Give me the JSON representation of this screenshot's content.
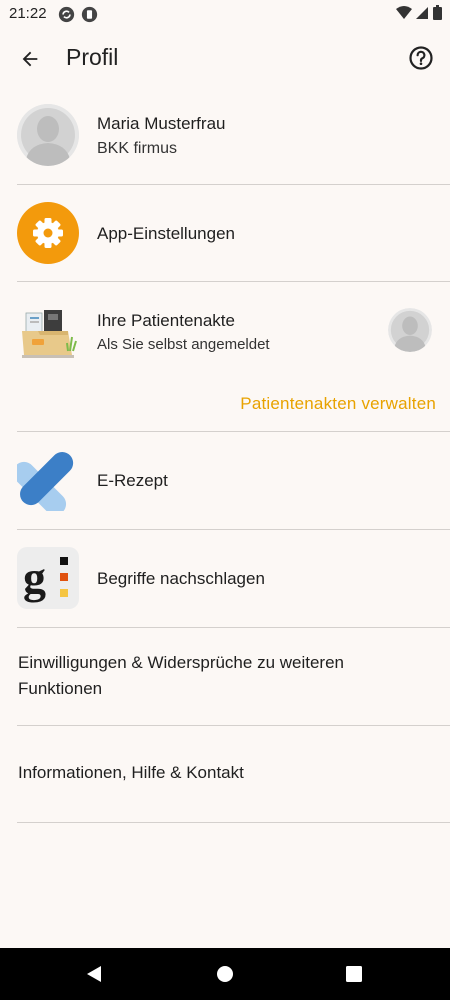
{
  "status_bar": {
    "time": "21:22"
  },
  "app_bar": {
    "title": "Profil"
  },
  "profile": {
    "name": "Maria Musterfrau",
    "insurance": "BKK firmus"
  },
  "app_settings": {
    "label": "App-Einstellungen"
  },
  "patient_record": {
    "title": "Ihre Patientenakte",
    "subtitle": "Als Sie selbst angemeldet",
    "manage_link": "Patientenakten verwalten"
  },
  "erezept": {
    "label": "E-Rezept"
  },
  "glossary": {
    "label": "Begriffe nachschlagen"
  },
  "consents": {
    "label": "Einwilligungen & Widersprüche zu weiteren Funktionen"
  },
  "info": {
    "label": "Informationen, Hilfe & Kontakt"
  },
  "colors": {
    "accent_orange": "#f39a0c",
    "link_yellow": "#e8a200",
    "background": "#fcf8f5"
  },
  "icons": [
    "back-arrow-icon",
    "help-icon",
    "avatar-icon",
    "gear-icon",
    "patient-record-icon",
    "erezept-icon",
    "glossary-icon"
  ]
}
